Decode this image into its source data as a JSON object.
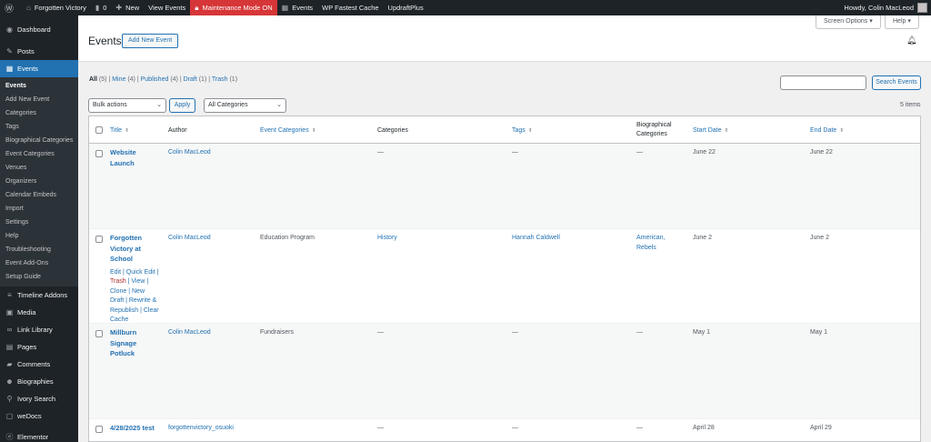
{
  "admin_bar": {
    "site_name": "Forgotten Victory",
    "comments_count": "0",
    "new_label": "New",
    "view_events": "View Events",
    "maintenance": "Maintenance Mode ON",
    "events": "Events",
    "fastest_cache": "WP Fastest Cache",
    "updraft": "UpdraftPlus",
    "howdy": "Howdy, Colin MacLeod"
  },
  "sidebar": {
    "dashboard": "Dashboard",
    "posts": "Posts",
    "events": "Events",
    "submenu": [
      "Events",
      "Add New Event",
      "Categories",
      "Tags",
      "Biographical Categories",
      "Event Categories",
      "Venues",
      "Organizers",
      "Calendar Embeds",
      "Import",
      "Settings",
      "Help",
      "Troubleshooting",
      "Event Add-Ons",
      "Setup Guide"
    ],
    "after": [
      {
        "label": "Timeline Addons",
        "icon": "timeline-icon"
      },
      {
        "label": "Media",
        "icon": "media-icon"
      },
      {
        "label": "Link Library",
        "icon": "link-icon"
      },
      {
        "label": "Pages",
        "icon": "pages-icon"
      },
      {
        "label": "Comments",
        "icon": "comments-icon"
      },
      {
        "label": "Biographies",
        "icon": "person-icon"
      },
      {
        "label": "Ivory Search",
        "icon": "search-icon"
      },
      {
        "label": "weDocs",
        "icon": "docs-icon"
      },
      {
        "label": "Elementor",
        "icon": "elementor-icon"
      }
    ]
  },
  "header": {
    "title": "Events",
    "add_new": "Add New Event",
    "screen_options": "Screen Options ▾",
    "help": "Help ▾"
  },
  "filters": {
    "all": "All",
    "all_count": "(5)",
    "mine": "Mine",
    "mine_count": "(4)",
    "published": "Published",
    "published_count": "(4)",
    "draft": "Draft",
    "draft_count": "(1)",
    "trash": "Trash",
    "trash_count": "(1)",
    "bulk_actions": "Bulk actions",
    "apply": "Apply",
    "all_categories": "All Categories",
    "search_button": "Search Events",
    "search_value": "",
    "items_count": "5 items"
  },
  "table": {
    "columns": {
      "title": "Title",
      "author": "Author",
      "event_categories": "Event Categories",
      "categories": "Categories",
      "tags": "Tags",
      "bio_line1": "Biographical",
      "bio_line2": "Categories",
      "start": "Start Date",
      "end": "End Date"
    },
    "rows": [
      {
        "title": [
          "Website",
          "Launch"
        ],
        "author": "Colin MacLeod",
        "event_categories": "",
        "categories": "—",
        "tags": "—",
        "bio": [
          "—"
        ],
        "start": "June 22",
        "end": "June 22",
        "actions": []
      },
      {
        "title": [
          "Forgotten",
          "Victory at",
          "School"
        ],
        "author": "Colin MacLeod",
        "event_categories": "Education Program",
        "categories": "History",
        "tags": "Hannah Caldwell",
        "bio": [
          "American,",
          "Rebels"
        ],
        "start": "June 2",
        "end": "June 2",
        "actions": [
          "Edit | Quick Edit |",
          "Trash",
          " | View |",
          "Clone | New",
          "Draft | Rewrite &",
          "Republish | Clear",
          "Cache"
        ]
      },
      {
        "title": [
          "Millburn",
          "Signage",
          "Potluck"
        ],
        "author": "Colin MacLeod",
        "event_categories": "Fundraisers",
        "categories": "—",
        "tags": "—",
        "bio": [
          "—"
        ],
        "start": "May 1",
        "end": "May 1",
        "actions": []
      },
      {
        "title": [
          "4/28/2025 test"
        ],
        "author": "forgottenvictory_osuoki",
        "event_categories": "",
        "categories": "—",
        "tags": "—",
        "bio": [
          "—"
        ],
        "start": "April 28",
        "end": "April 29",
        "actions": []
      }
    ]
  }
}
